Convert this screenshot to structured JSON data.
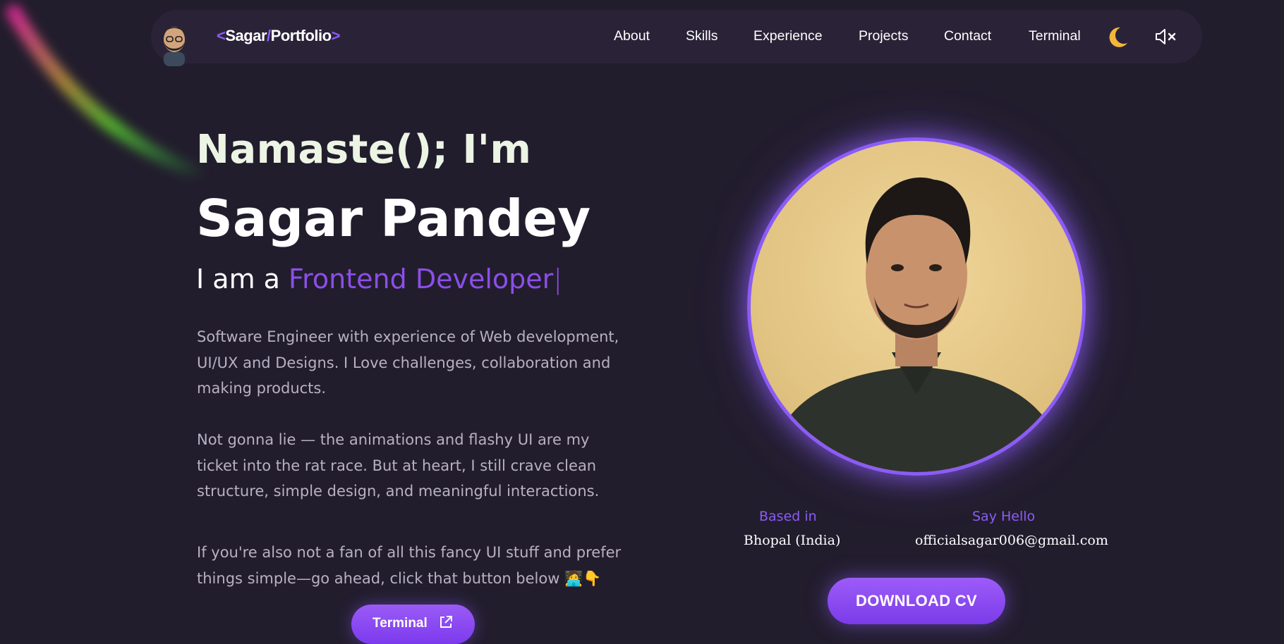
{
  "header": {
    "logo": {
      "open": "<",
      "first": "Sagar",
      "slash": "/",
      "second": "Portfolio",
      "close": ">"
    },
    "nav": [
      "About",
      "Skills",
      "Experience",
      "Projects",
      "Contact",
      "Terminal"
    ],
    "icons": {
      "theme": "moon-icon",
      "sound": "speaker-muted-icon",
      "avatar": "avatar-icon"
    }
  },
  "hero": {
    "greeting": "Namaste(); I'm",
    "name": "Sagar Pandey",
    "role_prefix": "I am a ",
    "role": "Frontend Developer",
    "caret": "|",
    "bio_1": "Software Engineer with experience of Web development, UI/UX and Designs. I Love challenges, collaboration and making products.",
    "bio_2": "Not gonna lie — the animations and flashy UI are my ticket into the rat race. But at heart, I still crave clean structure, simple design, and meaningful interactions.",
    "bio_3": "If you're also not a fan of all this fancy UI stuff and prefer things simple—go ahead, click that button below 🧑‍💻👇",
    "terminal_button": "Terminal"
  },
  "profile": {
    "based_in_label": "Based in",
    "based_in_value": "Bhopal (India)",
    "say_hello_label": "Say Hello",
    "email": "officialsagar006@gmail.com",
    "download_cv": "DOWNLOAD CV"
  },
  "colors": {
    "background": "#221d2d",
    "accent": "#8b5cf6",
    "nav_bg": "#2a2338"
  }
}
